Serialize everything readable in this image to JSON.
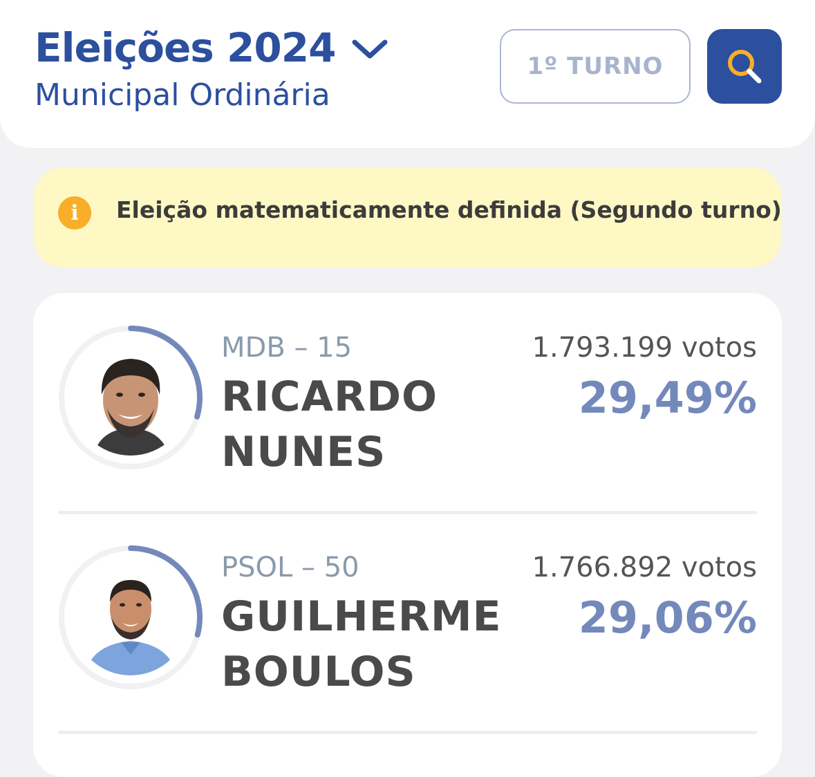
{
  "header": {
    "title": "Eleições 2024",
    "subtitle": "Municipal Ordinária",
    "turno_label": "1º TURNO",
    "dropdown_icon": "chevron-down-icon",
    "search_icon": "search-icon"
  },
  "notice": {
    "icon": "info-icon",
    "icon_glyph": "i",
    "text": "Eleição matematicamente definida (Segundo turno)"
  },
  "candidates": [
    {
      "party": "MDB – 15",
      "name_line1": "RICARDO",
      "name_line2": "NUNES",
      "votes": "1.793.199 votos",
      "percent": "29,49%",
      "percent_value": 29.49
    },
    {
      "party": "PSOL – 50",
      "name_line1": "GUILHERME",
      "name_line2": "BOULOS",
      "votes": "1.766.892 votos",
      "percent": "29,06%",
      "percent_value": 29.06
    }
  ],
  "colors": {
    "brand": "#2c4f9e",
    "accent_yellow": "#f8ae29",
    "percent": "#7489bb",
    "ring": "#7489bb",
    "notice_bg": "#fdf8c4"
  }
}
